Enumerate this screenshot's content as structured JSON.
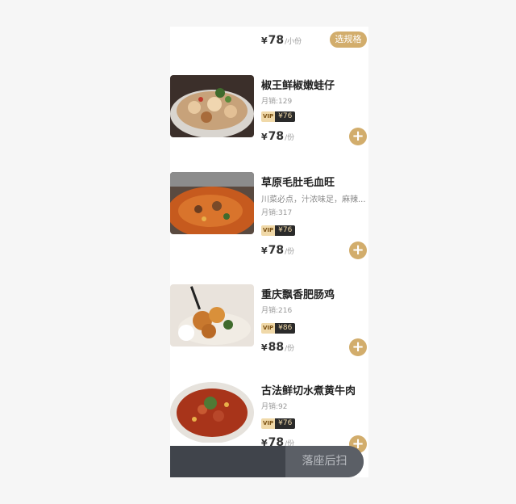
{
  "top": {
    "price_symbol": "¥",
    "price": "78",
    "unit": "/小份",
    "spec_button": "选规格"
  },
  "items": [
    {
      "name": "椒王鲜椒嫩蛙仔",
      "description": "",
      "sales": "月销:129",
      "vip_tag": "VIP",
      "vip_price": "¥76",
      "price_symbol": "¥",
      "price": "78",
      "unit": "/份",
      "add_icon": "+"
    },
    {
      "name": "草原毛肚毛血旺",
      "description": "川菜必点，汁浓味足，麻辣...",
      "sales": "月销:317",
      "vip_tag": "VIP",
      "vip_price": "¥76",
      "price_symbol": "¥",
      "price": "78",
      "unit": "/份",
      "add_icon": "+"
    },
    {
      "name": "重庆飘香肥肠鸡",
      "description": "",
      "sales": "月销:216",
      "vip_tag": "VIP",
      "vip_price": "¥86",
      "price_symbol": "¥",
      "price": "88",
      "unit": "/份",
      "add_icon": "+"
    },
    {
      "name": "古法鲜切水煮黄牛肉",
      "description": "",
      "sales": "月销:92",
      "vip_tag": "VIP",
      "vip_price": "¥76",
      "price_symbol": "¥",
      "price": "78",
      "unit": "/份",
      "add_icon": "+"
    }
  ],
  "cart": {
    "button_label": "落座后扫"
  },
  "colors": {
    "accent": "#d2ad6c",
    "cart_bar": "#40444b",
    "vip_dark": "#2a2a2a",
    "vip_gold": "#f0d9a9"
  }
}
